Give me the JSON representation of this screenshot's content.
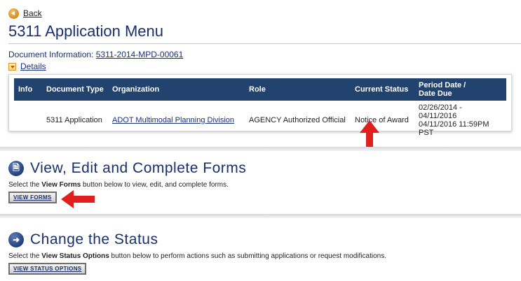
{
  "nav": {
    "back_label": "Back"
  },
  "page": {
    "title": "5311 Application Menu"
  },
  "document_info": {
    "label": "Document Information:",
    "doc_id": "5311-2014-MPD-00061",
    "details_label": "Details"
  },
  "table": {
    "headers": {
      "info": "Info",
      "type": "Document Type",
      "org": "Organization",
      "role": "Role",
      "status": "Current Status",
      "period_line1": "Period Date /",
      "period_line2": "Date Due"
    },
    "row": {
      "info": "",
      "type": "5311 Application",
      "org": "ADOT Multimodal Planning Division",
      "role": "AGENCY Authorized Official",
      "status": "Notice of Award",
      "period": "02/26/2014 - 04/11/2016",
      "due": "04/11/2016 11:59PM PST"
    }
  },
  "forms_section": {
    "title": "View, Edit and Complete Forms",
    "desc_pre": "Select the ",
    "desc_bold": "View Forms",
    "desc_post": " button below to view, edit, and complete forms.",
    "button_label": "VIEW FORMS"
  },
  "status_section": {
    "title": "Change the Status",
    "desc_pre": "Select the ",
    "desc_bold": "View Status Options",
    "desc_post": " button below to perform actions such as submitting applications or request modifications.",
    "button_label": "VIEW STATUS OPTIONS"
  },
  "colors": {
    "header_bg": "#23436f",
    "title": "#1b2f6b",
    "annotation_arrow": "#e0201e"
  }
}
